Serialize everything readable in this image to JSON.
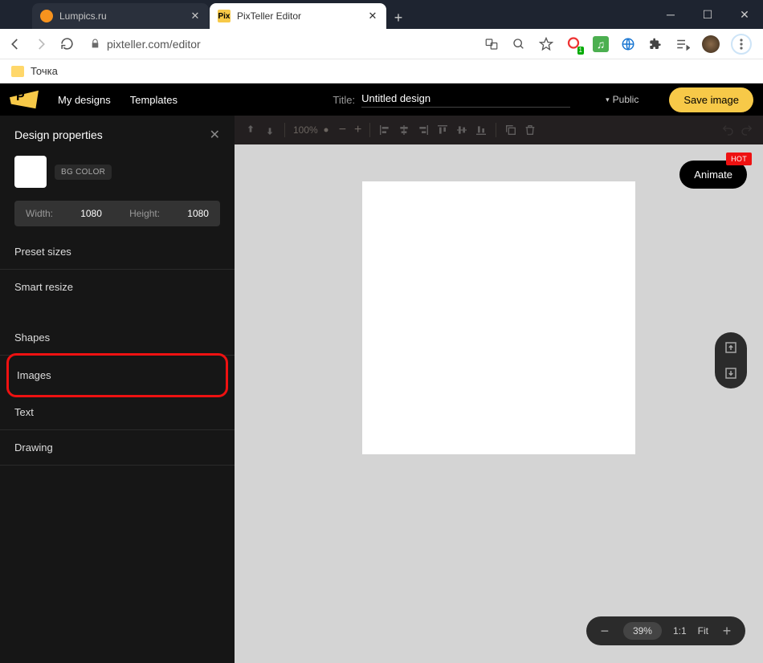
{
  "browser": {
    "tabs": [
      {
        "title": "Lumpics.ru",
        "active": false
      },
      {
        "title": "PixTeller Editor",
        "active": true
      }
    ],
    "url": "pixteller.com/editor",
    "bookmark": "Точка"
  },
  "header": {
    "nav_my_designs": "My designs",
    "nav_templates": "Templates",
    "title_label": "Title:",
    "title_value": "Untitled design",
    "visibility": "Public",
    "save_label": "Save image"
  },
  "sidebar": {
    "panel_title": "Design properties",
    "bg_label": "BG COLOR",
    "width_label": "Width:",
    "width_value": "1080",
    "height_label": "Height:",
    "height_value": "1080",
    "preset_sizes": "Preset sizes",
    "smart_resize": "Smart resize",
    "shapes": "Shapes",
    "images": "Images",
    "text": "Text",
    "drawing": "Drawing"
  },
  "toolbar": {
    "zoom_label": "100%"
  },
  "canvas": {
    "animate_label": "Animate",
    "hot_label": "HOT"
  },
  "zoom": {
    "percent": "39%",
    "one_to_one": "1:1",
    "fit": "Fit"
  }
}
